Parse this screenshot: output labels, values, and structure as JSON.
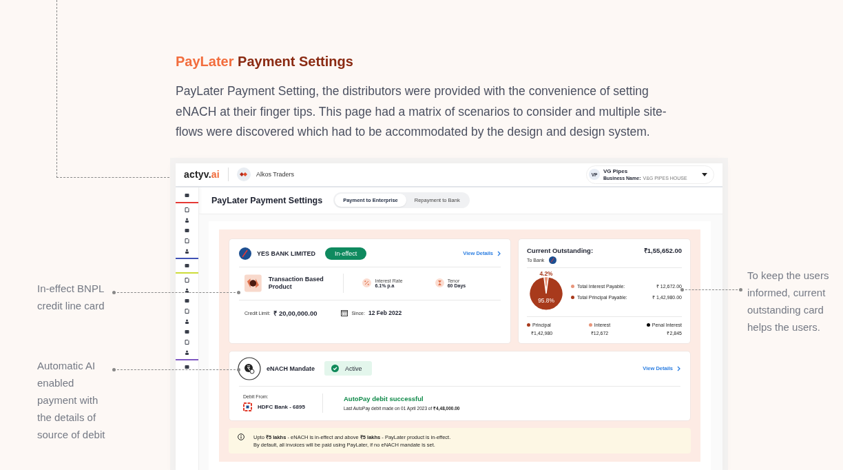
{
  "heading": {
    "accent": "PayLater",
    "text": "Payment Settings"
  },
  "intro": "PayLater Payment Setting, the distributors were provided with the convenience of setting eNACH at their finger tips. This page had a matrix of scenarios to consider and multiple site-flows were discovered which had to be accommodated by the design and design system.",
  "left_notes": [
    "In-effect BNPL credit line card",
    "Automatic AI enabled payment with the details of source of debit"
  ],
  "right_notes": [
    "To keep the users informed, current outstanding card helps the users."
  ],
  "app": {
    "logo": {
      "text": "actyv.",
      "accent": "ai"
    },
    "company": "Alkos Traders",
    "user": {
      "initials": "VP",
      "name": "VG Pipes",
      "business_label": "Business Name:",
      "business": "V&G PIPES HOUSE"
    },
    "title": "PayLater Payment Settings",
    "tabs": [
      {
        "label": "Payment to Enterprise",
        "selected": true
      },
      {
        "label": "Repayment to Bank",
        "selected": false
      }
    ],
    "credit_card": {
      "bank": "YES BANK LIMITED",
      "status": "In-effect",
      "link": "View Details",
      "product": "Transaction Based Product",
      "stats": [
        {
          "kind": "rate",
          "label": "Interest Rate",
          "value": "6.1% p.a"
        },
        {
          "kind": "tenor",
          "label": "Tenor",
          "value": "60 Days"
        }
      ],
      "limit_label": "Credit Limit:",
      "limit": "₹ 20,00,000.00",
      "since_label": "Since:",
      "since": "12 Feb 2022"
    },
    "outstanding": {
      "title": "Current Outstanding:",
      "amount": "₹1,55,652.00",
      "to": "To Bank",
      "chart_data": {
        "type": "pie",
        "values": [
          4.2,
          95.8
        ],
        "value_labels": [
          "4.2%",
          "95.8%"
        ]
      },
      "payables": [
        {
          "label": "Total Interest Payable:",
          "value": "₹ 12,672.00",
          "color": "#e8957a"
        },
        {
          "label": "Total Principal Payable:",
          "value": "₹ 1,42,980.00",
          "color": "#a83a1c"
        }
      ],
      "breakdown": [
        {
          "label": "Principal",
          "value": "₹1,42,980",
          "color": "#a83a1c"
        },
        {
          "label": "Interest",
          "value": "₹12,672",
          "color": "#e8957a"
        },
        {
          "label": "Penal Interest",
          "value": "₹2,845",
          "color": "#000000"
        }
      ]
    },
    "mandate": {
      "title": "eNACH Mandate",
      "status": "Active",
      "link": "View Details",
      "debit_label": "Debit From:",
      "bank": "HDFC Bank - 6895",
      "result": "AutoPay debit successful",
      "detail": "Last AutoPay debit made on 01 April 2023 of **₹4,48,000.00**"
    },
    "note": [
      "Upto **₹5 lakhs** -  eNACH is in-effect and above **₹5 lakhs** - PayLater product is in-effect.",
      "By default, all invoices will be paid using PayLater, if no eNACH mandate is set."
    ]
  }
}
